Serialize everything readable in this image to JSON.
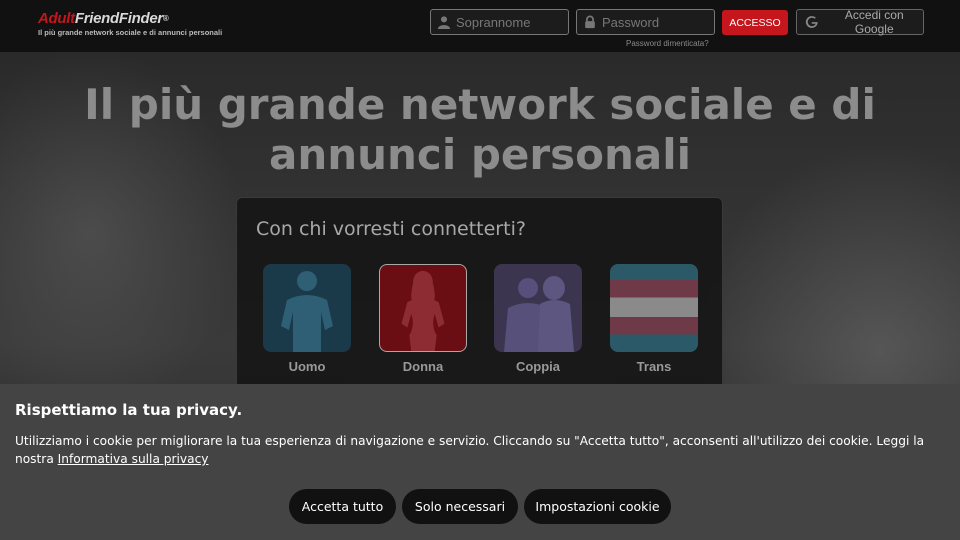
{
  "header": {
    "logo": {
      "adult": "Adult",
      "rest": "FriendFinder",
      "reg": "®",
      "tagline": "Il più grande network sociale e di annunci personali"
    },
    "nickname_placeholder": "Soprannome",
    "password_placeholder": "Password",
    "forgot_password": "Password dimenticata?",
    "login_button": "ACCESSO",
    "google_button": "Accedi con Google",
    "icons": {
      "user": "user-icon",
      "lock": "lock-icon",
      "google": "google-icon"
    }
  },
  "hero": {
    "title": "Il più grande network sociale e di annunci personali"
  },
  "panel": {
    "question": "Con chi vorresti connetterti?",
    "choices": [
      {
        "label": "Uomo"
      },
      {
        "label": "Donna"
      },
      {
        "label": "Coppia"
      },
      {
        "label": "Trans"
      }
    ]
  },
  "cookie": {
    "title": "Rispettiamo la tua privacy.",
    "text": "Utilizziamo i cookie per migliorare la tua esperienza di navigazione e servizio. Cliccando su \"Accetta tutto\", acconsenti all'utilizzo dei cookie. Leggi la nostra ",
    "link": "Informativa sulla privacy",
    "buttons": {
      "accept_all": "Accetta tutto",
      "necessary_only": "Solo necessari",
      "settings": "Impostazioni cookie"
    }
  },
  "colors": {
    "brand_red": "#c4161c",
    "header_bg": "#111111",
    "cookie_bg": "#444444",
    "button_dark": "#111111"
  }
}
